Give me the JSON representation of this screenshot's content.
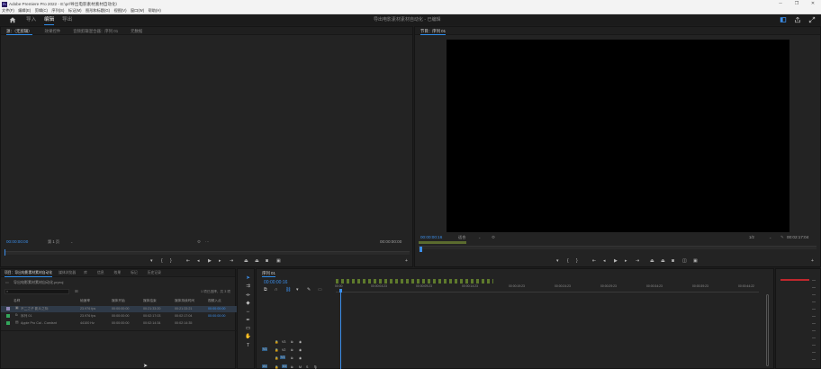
{
  "window": {
    "app_logo": "Pr",
    "title": "Adobe Premiere Pro 2022 - E:\\pr\\导出电影素材素材自动化\\",
    "minimize": "─",
    "restore": "❐",
    "close": "✕"
  },
  "menu": [
    "文件(F)",
    "编辑(E)",
    "剪辑(C)",
    "序列(S)",
    "标记(M)",
    "图形和标题(G)",
    "视图(V)",
    "窗口(W)",
    "帮助(H)"
  ],
  "header": {
    "tabs": [
      {
        "label": "导入",
        "active": false
      },
      {
        "label": "编辑",
        "active": true
      },
      {
        "label": "导出",
        "active": false
      }
    ],
    "project_title": "导出电影素材素材自动化 - 已编辑"
  },
  "source_monitor": {
    "tabs": [
      "源：（无剪辑）",
      "效果控件",
      "音频剪辑混合器：序列 01",
      "元数据"
    ],
    "timecode_left": "00:00:00:00",
    "fit_label": "适合",
    "zoom_label": "第 1 页",
    "timecode_right": "00:00:00:00"
  },
  "program_monitor": {
    "tab": "节目：序列 01",
    "timecode_left": "00:00:00:16",
    "fit_label": "适合",
    "resolution": "1/2",
    "timecode_right": "00:02:17:04"
  },
  "project_panel": {
    "tabs": [
      "项目：导出电影素材素材自动化",
      "媒体浏览器",
      "库",
      "信息",
      "效果",
      "标记",
      "历史记录"
    ],
    "project_file": "导出电影素材素材自动化.prproj",
    "search_placeholder": "",
    "selection_info": "1 项已选择，共 3 项",
    "columns": [
      "名称",
      "帧速率",
      "媒体开始",
      "媒体结束",
      "媒体持续时间",
      "视频入点"
    ],
    "rows": [
      {
        "name": "不二之子 影片之际",
        "fps": "23.976 fps",
        "start": "00:00:00:00",
        "end": "00:21:33:20",
        "dur": "00:21:33:21",
        "in": "00:00:00:00",
        "color": "#8f86b5"
      },
      {
        "name": "序列 01",
        "fps": "23.976 fps",
        "start": "00:00:00:00",
        "end": "00:02:17:03",
        "dur": "00:02:17:04",
        "in": "00:00:00:00",
        "color": "#33a65b"
      },
      {
        "name": "Apple Pro Cal - Coedsnt",
        "fps": "44100 Hz",
        "start": "00:00:00:00",
        "end": "00:02:14:34",
        "dur": "00:02:14:35",
        "in": "",
        "color": "#33a65b"
      }
    ]
  },
  "timeline": {
    "tab": "序列 01",
    "timecode": "00:00:00:16",
    "ruler": [
      "00:00",
      "00:00:04:23",
      "00:00:09:23",
      "00:00:14:23",
      "00:00:19:23",
      "00:00:24:23",
      "00:00:29:23",
      "00:00:34:23",
      "00:00:39:23",
      "00:00:44:22"
    ],
    "tracks": [
      {
        "name": "V3"
      },
      {
        "name": "V2"
      },
      {
        "name": "V1"
      },
      {
        "name": "A1"
      }
    ]
  },
  "colors": {
    "accent": "#2d8ceb",
    "playhead": "#3b8eea",
    "meter_peak": "#c0272d"
  }
}
